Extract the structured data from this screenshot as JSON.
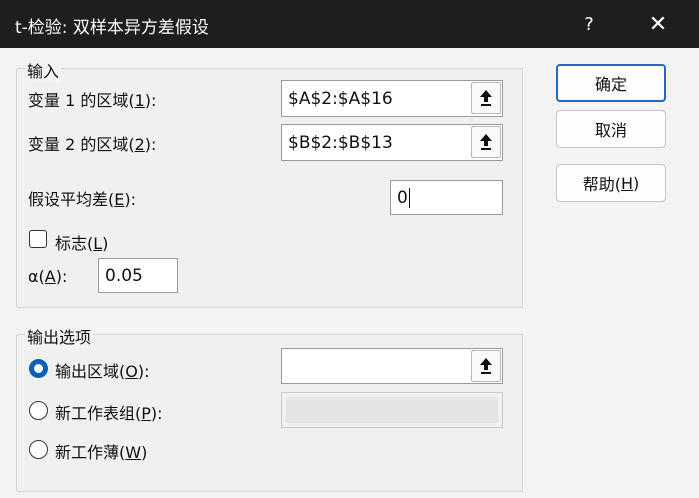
{
  "window": {
    "title": "t-检验: 双样本异方差假设",
    "help_glyph": "?",
    "close_glyph": "✕"
  },
  "input_group": {
    "label": "输入",
    "var1": {
      "label": "变量 1 的区域(",
      "key": "1",
      "suffix": "):",
      "value": "$A$2:$A$16"
    },
    "var2": {
      "label": "变量 2 的区域(",
      "key": "2",
      "suffix": "):",
      "value": "$B$2:$B$13"
    },
    "mean_diff": {
      "label": "假设平均差(",
      "key": "E",
      "suffix": "):",
      "value": "0"
    },
    "labels": {
      "label": "标志(",
      "key": "L",
      "suffix": ")",
      "checked": false
    },
    "alpha": {
      "label": "α(",
      "key": "A",
      "suffix": "):",
      "value": "0.05"
    }
  },
  "output_group": {
    "label": "输出选项",
    "output_range": {
      "label": "输出区域(",
      "key": "O",
      "suffix": "):",
      "value": "",
      "selected": true
    },
    "new_sheet": {
      "label": "新工作表组(",
      "key": "P",
      "suffix": "):",
      "value": "",
      "selected": false
    },
    "new_workbook": {
      "label": "新工作薄(",
      "key": "W",
      "suffix": ")",
      "selected": false
    }
  },
  "buttons": {
    "ok": "确定",
    "cancel": "取消",
    "help": {
      "label": "帮助(",
      "key": "H",
      "suffix": ")"
    }
  },
  "icons": {
    "ref_button": "collapse-dialog-arrow-up-icon",
    "help": "question-mark-icon",
    "close": "close-icon"
  },
  "colors": {
    "titlebar": "#1e1e1e",
    "accent": "#1b6ac9",
    "radio_selected": "#0a5fb8"
  }
}
